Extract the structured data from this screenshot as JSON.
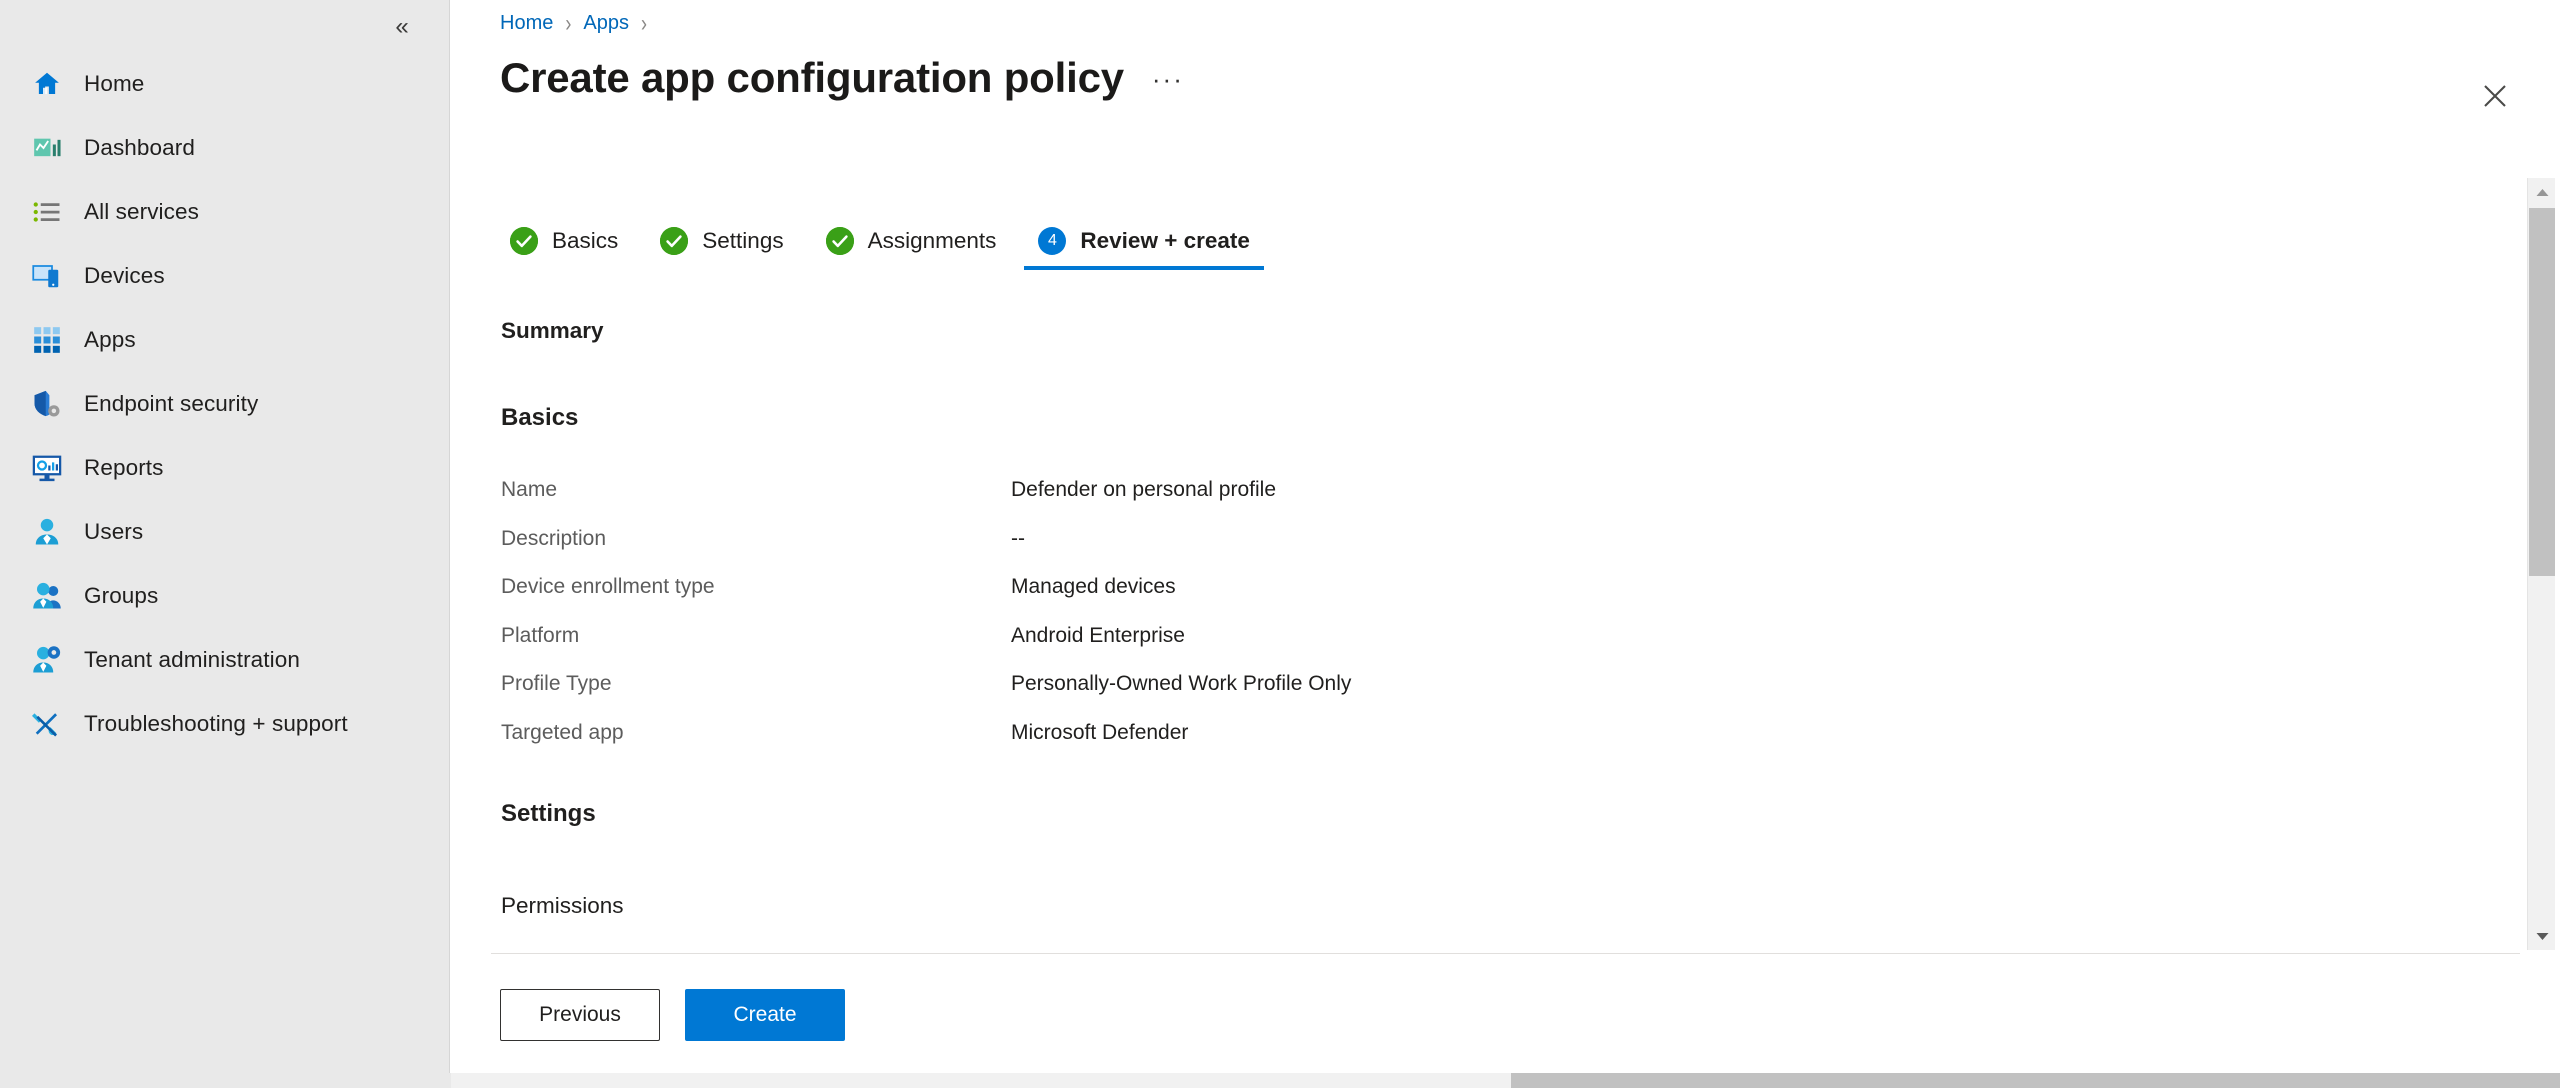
{
  "sidebar": {
    "collapse_icon": "chevron-double-left-icon",
    "items": [
      {
        "label": "Home",
        "icon": "home-icon"
      },
      {
        "label": "Dashboard",
        "icon": "dashboard-icon"
      },
      {
        "label": "All services",
        "icon": "all-services-list-icon"
      },
      {
        "label": "Devices",
        "icon": "devices-icon"
      },
      {
        "label": "Apps",
        "icon": "apps-grid-icon"
      },
      {
        "label": "Endpoint security",
        "icon": "shield-gear-icon"
      },
      {
        "label": "Reports",
        "icon": "reports-monitor-icon"
      },
      {
        "label": "Users",
        "icon": "user-icon"
      },
      {
        "label": "Groups",
        "icon": "groups-icon"
      },
      {
        "label": "Tenant administration",
        "icon": "user-gear-icon"
      },
      {
        "label": "Troubleshooting + support",
        "icon": "wrench-screwdriver-icon"
      }
    ]
  },
  "breadcrumb": {
    "items": [
      "Home",
      "Apps"
    ],
    "separator": "›"
  },
  "header": {
    "title": "Create app configuration policy",
    "ellipsis_label": "···",
    "close_icon": "close-icon"
  },
  "wizard": {
    "tabs": [
      {
        "label": "Basics",
        "state": "done",
        "marker": "check-icon"
      },
      {
        "label": "Settings",
        "state": "done",
        "marker": "check-icon"
      },
      {
        "label": "Assignments",
        "state": "done",
        "marker": "check-icon"
      },
      {
        "label": "Review + create",
        "state": "current",
        "marker": "4"
      }
    ]
  },
  "main": {
    "summary_heading": "Summary",
    "basics_heading": "Basics",
    "basics_rows": [
      {
        "key": "Name",
        "value": "Defender on personal profile"
      },
      {
        "key": "Description",
        "value": "--"
      },
      {
        "key": "Device enrollment type",
        "value": "Managed devices"
      },
      {
        "key": "Platform",
        "value": "Android Enterprise"
      },
      {
        "key": "Profile Type",
        "value": "Personally-Owned Work Profile Only"
      },
      {
        "key": "Targeted app",
        "value": "Microsoft Defender"
      }
    ],
    "settings_heading": "Settings",
    "permissions_label": "Permissions"
  },
  "footer": {
    "previous_label": "Previous",
    "create_label": "Create"
  },
  "colors": {
    "accent": "#0078d4",
    "link": "#0067b8",
    "success": "#3aa017",
    "sidebar_bg": "#e9e9e9",
    "text": "#201f1e",
    "muted_text": "#5c5c5c",
    "scrollbar_thumb": "#c1c1c1"
  }
}
